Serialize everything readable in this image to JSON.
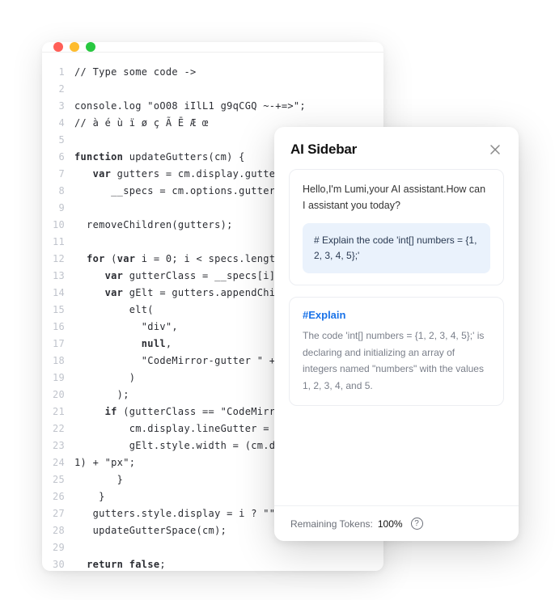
{
  "editor": {
    "lines": [
      "// Type some code ->",
      "",
      "console.log \"oO08 iIlL1 g9qCGQ ~-+=>\";",
      "// à é ù ï ø ç Ã Ē Æ œ",
      "",
      "function updateGutters(cm) {",
      "   var gutters = cm.display.gutters,",
      "      __specs = cm.options.gutters;",
      "",
      "  removeChildren(gutters);",
      "",
      "  for (var i = 0; i < specs.length; ++i) {",
      "     var gutterClass = __specs[i];",
      "     var gElt = gutters.appendChild(",
      "         elt(",
      "           \"div\",",
      "           null,",
      "           \"CodeMirror-gutter \" + gutterClass",
      "         )",
      "       );",
      "     if (gutterClass == \"CodeMirror-linenumbers\") {",
      "         cm.display.lineGutter = gElt;",
      "         gElt.style.width = (cm.display.lineNumWidth ||",
      "1) + \"px\";",
      "       }",
      "    }",
      "   gutters.style.display = i ? \"\" : \"none\";",
      "   updateGutterSpace(cm);",
      "",
      "  return false;",
      "}"
    ]
  },
  "sidebar": {
    "title": "AI Sidebar",
    "greeting": "Hello,I'm Lumi,your AI assistant.How can I assistant you today?",
    "user_message": "# Explain the code 'int[] numbers = {1, 2, 3, 4, 5};'",
    "explain_heading": "#Explain",
    "explain_body": "The code 'int[] numbers = {1, 2, 3, 4, 5};' is declaring and initializing an array of integers named \"numbers\" with the values 1, 2, 3, 4, and 5.",
    "footer_label": "Remaining Tokens:",
    "footer_value": "100%",
    "help_glyph": "?"
  }
}
